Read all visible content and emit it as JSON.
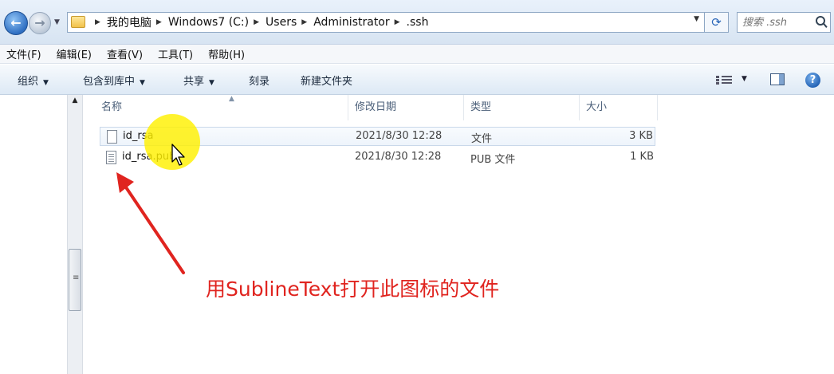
{
  "address_bar": {
    "crumbs": [
      "我的电脑",
      "Windows7 (C:)",
      "Users",
      "Administrator",
      ".ssh"
    ],
    "search_placeholder": "搜索 .ssh"
  },
  "menu": [
    "文件(F)",
    "编辑(E)",
    "查看(V)",
    "工具(T)",
    "帮助(H)"
  ],
  "toolbar": {
    "organize": "组织",
    "include_in_library": "包含到库中",
    "share": "共享",
    "burn": "刻录",
    "new_folder": "新建文件夹"
  },
  "columns": {
    "name": "名称",
    "date_modified": "修改日期",
    "type": "类型",
    "size": "大小"
  },
  "files": [
    {
      "name": "id_rsa",
      "date": "2021/8/30 12:28",
      "type": "文件",
      "size": "3 KB"
    },
    {
      "name": "id_rsa.pub",
      "date": "2021/8/30 12:28",
      "type": "PUB 文件",
      "size": "1 KB"
    }
  ],
  "annotation": "用SublineText打开此图标的文件",
  "colors": {
    "annotation": "#e0241f",
    "cursor_highlight": "#fff000",
    "accent": "#2f6fc2"
  }
}
